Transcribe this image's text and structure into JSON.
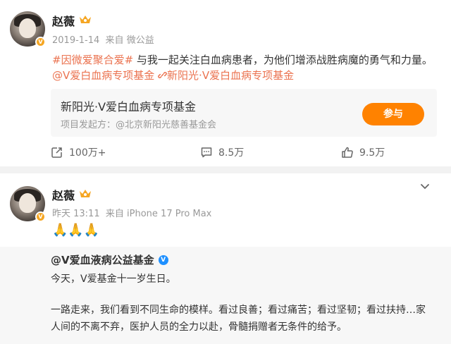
{
  "post1": {
    "author": "赵薇",
    "time": "2019-1-14",
    "source_prefix": "来自",
    "source": "微公益",
    "hashtag": "#因微爱聚合爱#",
    "body": " 与我一起关注白血病患者，为他们增添战胜病魔的勇气和力量。",
    "mention": "@V爱白血病专项基金",
    "link_text": "新阳光·V爱白血病专项基金",
    "embed": {
      "title": "新阳光·V爱白血病专项基金",
      "subtitle": "项目发起方：@北京新阳光慈善基金会",
      "button": "参与"
    },
    "actions": {
      "repost": "100万+",
      "comment": "8.5万",
      "like": "9.5万"
    }
  },
  "post2": {
    "author": "赵薇",
    "time": "昨天 13:11",
    "source_prefix": "来自",
    "source": "iPhone 17 Pro Max",
    "body": "🙏🙏🙏",
    "quote": {
      "author": "@V爱血液病公益基金",
      "line1": "今天，V爱基金十一岁生日。",
      "line2": "一路走来，我们看到不同生命的模样。看过良善；看过痛苦；看过坚韧；看过扶持…家",
      "line3": "人间的不离不弃，医护人员的全力以赴，骨髓捐赠者无条件的给予。"
    }
  },
  "colors": {
    "accent": "#ff8200",
    "link": "#eb7350",
    "verified_yellow": "#f5a623",
    "verified_blue": "#1e90ff"
  }
}
